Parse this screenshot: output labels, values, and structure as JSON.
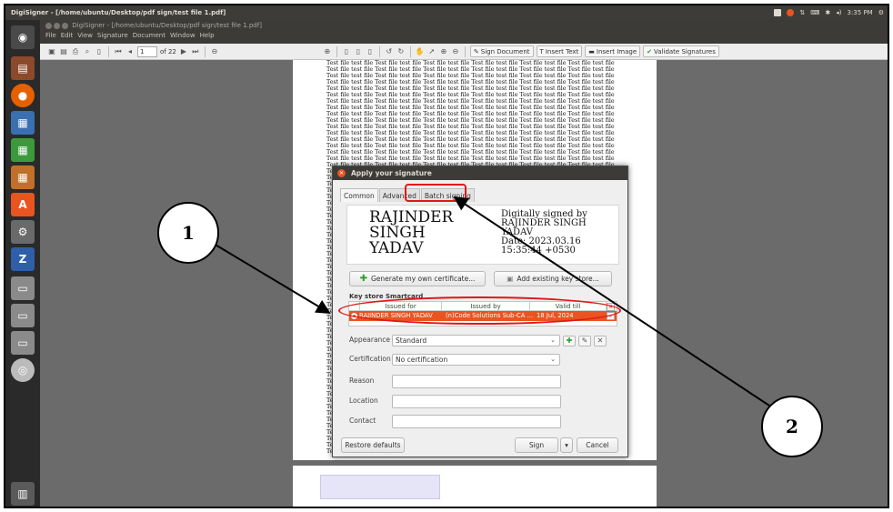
{
  "topbar": {
    "title": "DigiSigner - [/home/ubuntu/Desktop/pdf sign/test file 1.pdf]",
    "time": "3:35 PM",
    "icons": [
      "ubuntu-store-icon",
      "record-icon",
      "network-icon",
      "keyboard-icon",
      "bluetooth-icon",
      "volume-icon",
      "settings-icon"
    ]
  },
  "window": {
    "title": "DigiSigner - [/home/ubuntu/Desktop/pdf sign/test file 1.pdf]",
    "menu": [
      "File",
      "Edit",
      "View",
      "Signature",
      "Document",
      "Window",
      "Help"
    ]
  },
  "toolbar": {
    "page_value": "1",
    "page_total": "of 22",
    "sign_document": "Sign Document",
    "insert_text": "Insert Text",
    "insert_image": "Insert Image",
    "validate_signatures": "Validate Signatures"
  },
  "document": {
    "line_text": "Test file test file Test file test file Test file test file Test file test file Test file test file Test file test file",
    "line_short": "Te"
  },
  "dialog": {
    "title": "Apply your signature",
    "tabs": [
      "Common",
      "Advanced",
      "Batch signing"
    ],
    "preview": {
      "name_lines": [
        "RAJINDER",
        "SINGH",
        "YADAV"
      ],
      "right_lines": [
        "Digitally signed by",
        "RAJINDER SINGH",
        "YADAV",
        "Date: 2023.03.16",
        "15:35:44 +0530"
      ]
    },
    "generate_button": "Generate my own certificate...",
    "add_keystore_button": "Add existing key store...",
    "keystore_label": "Key store Smartcard",
    "keystore_columns": [
      "Issued for",
      "Issued by",
      "Valid till"
    ],
    "keystore_row": {
      "issued_for": "RAJINDER SINGH YADAV",
      "issued_by": "(n)Code Solutions Sub-CA ...",
      "valid_till": "18 Jul, 2024"
    },
    "appearance_label": "Appearance",
    "appearance_value": "Standard",
    "certification_label": "Certification",
    "certification_value": "No certification",
    "reason_label": "Reason",
    "location_label": "Location",
    "contact_label": "Contact",
    "restore_button": "Restore defaults",
    "sign_button": "Sign",
    "cancel_button": "Cancel"
  },
  "annotations": {
    "callout_1": "1",
    "callout_2": "2",
    "color": "#e01818"
  },
  "colors": {
    "accent": "#e95420",
    "panel": "#3c3b37"
  }
}
